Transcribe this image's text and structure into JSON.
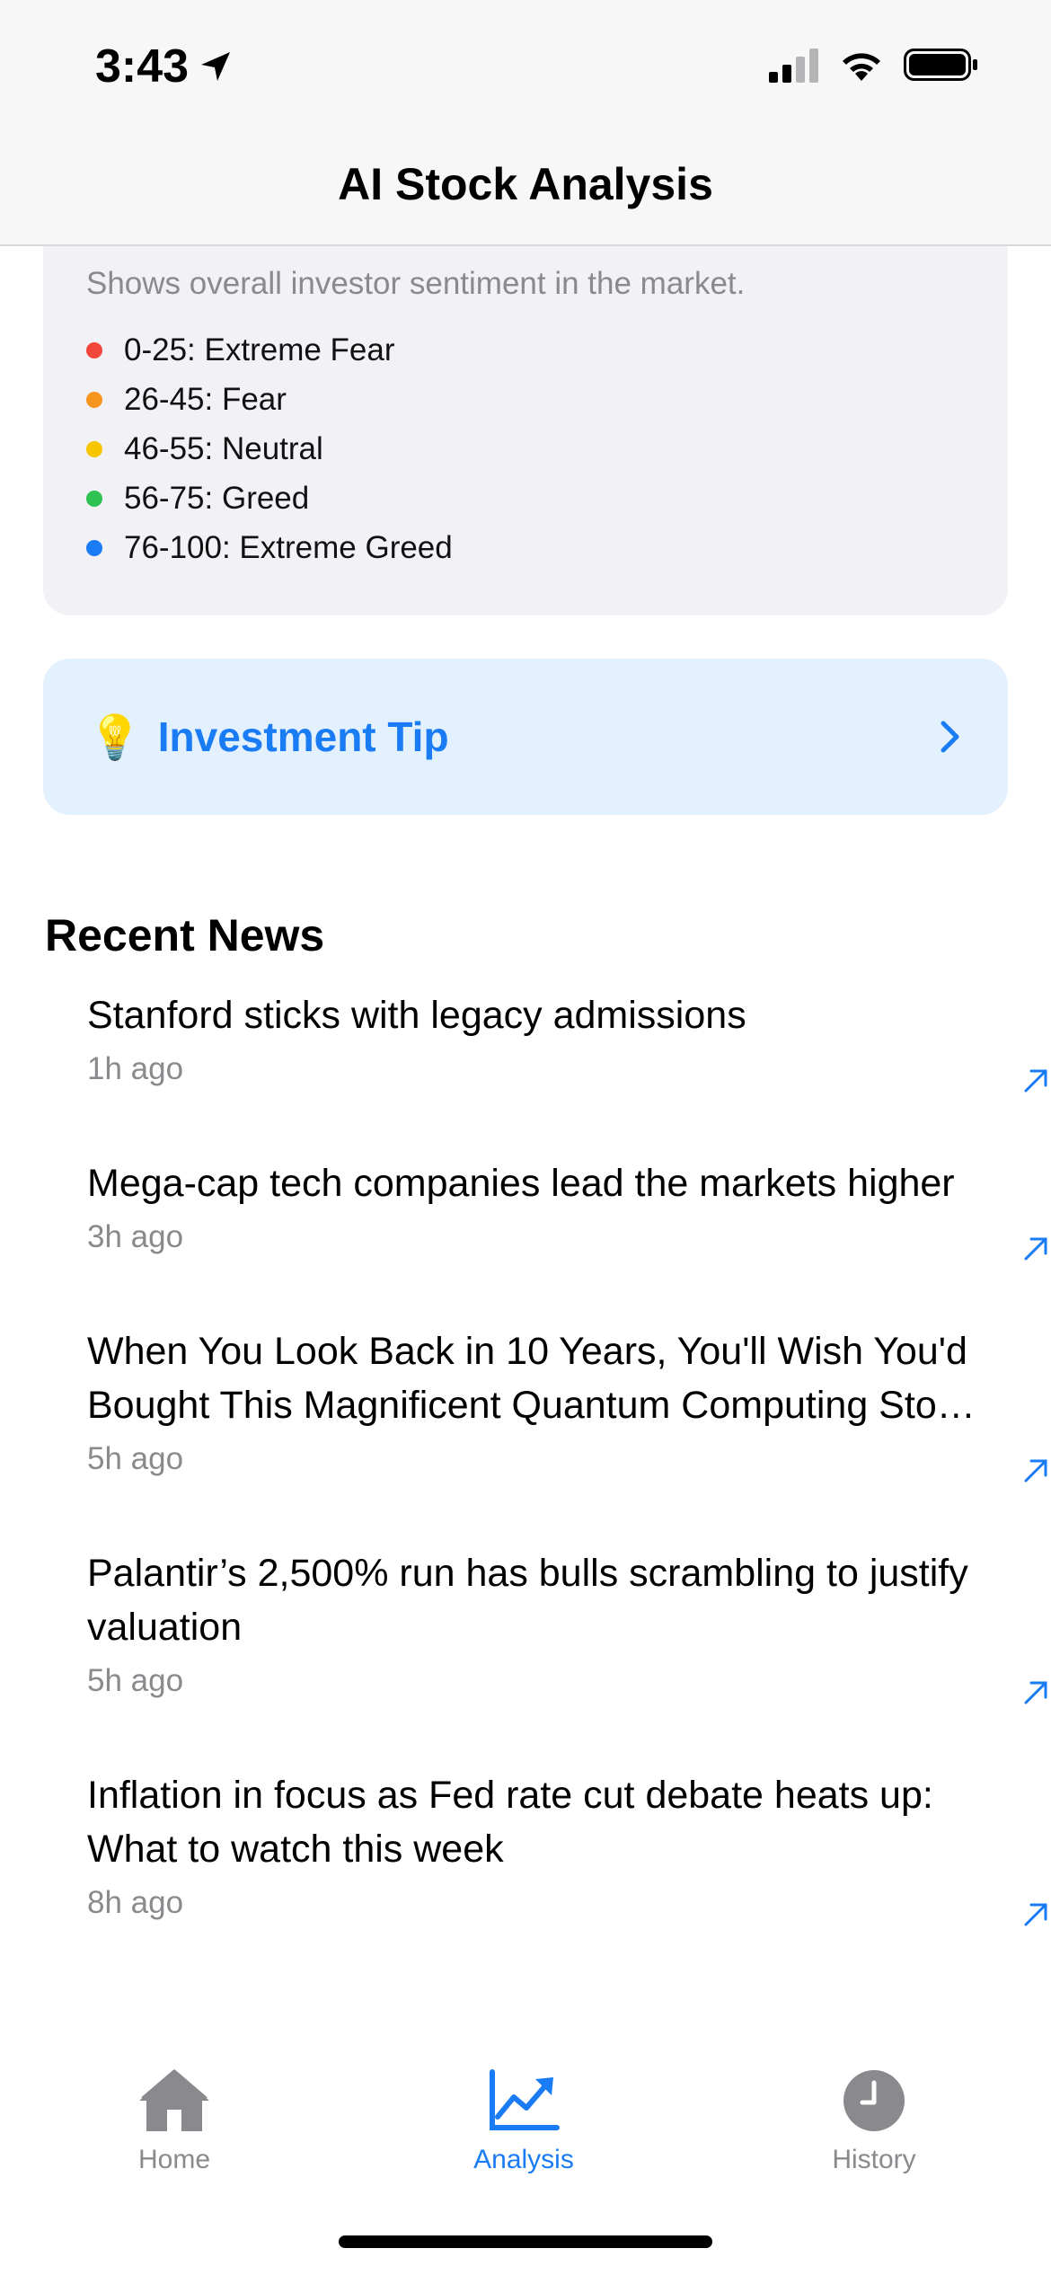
{
  "status_bar": {
    "time": "3:43"
  },
  "header": {
    "title": "AI Stock Analysis"
  },
  "sentiment_legend": {
    "description": "Shows overall investor sentiment in the market.",
    "items": [
      {
        "label": "0-25: Extreme Fear",
        "color": "#f2463d"
      },
      {
        "label": "26-45: Fear",
        "color": "#f7941d"
      },
      {
        "label": "46-55: Neutral",
        "color": "#f7c600"
      },
      {
        "label": "56-75: Greed",
        "color": "#2fc152"
      },
      {
        "label": "76-100: Extreme Greed",
        "color": "#1a7cf4"
      }
    ]
  },
  "investment_tip": {
    "emoji": "💡",
    "label": "Investment Tip",
    "chevron_icon": "chevron-right-icon"
  },
  "recent_news": {
    "title": "Recent News",
    "items": [
      {
        "title": "Stanford sticks with legacy admissions",
        "time": "1h ago"
      },
      {
        "title": "Mega-cap tech companies lead the markets higher",
        "time": "3h ago"
      },
      {
        "title": "When You Look Back in 10 Years, You'll Wish You'd Bought This Magnificent Quantum Computing Sto…",
        "time": "5h ago"
      },
      {
        "title": "Palantir’s 2,500% run has bulls scrambling to justify valuation",
        "time": "5h ago"
      },
      {
        "title": "Inflation in focus as Fed rate cut debate heats up: What to watch this week",
        "time": "8h ago"
      }
    ]
  },
  "tab_bar": {
    "tabs": [
      {
        "label": "Home",
        "icon": "house-icon",
        "active": false
      },
      {
        "label": "Analysis",
        "icon": "chart-line-up-icon",
        "active": true
      },
      {
        "label": "History",
        "icon": "clock-icon",
        "active": false
      }
    ],
    "active_color": "#1a7cf4",
    "inactive_color": "#8a8a8e"
  }
}
